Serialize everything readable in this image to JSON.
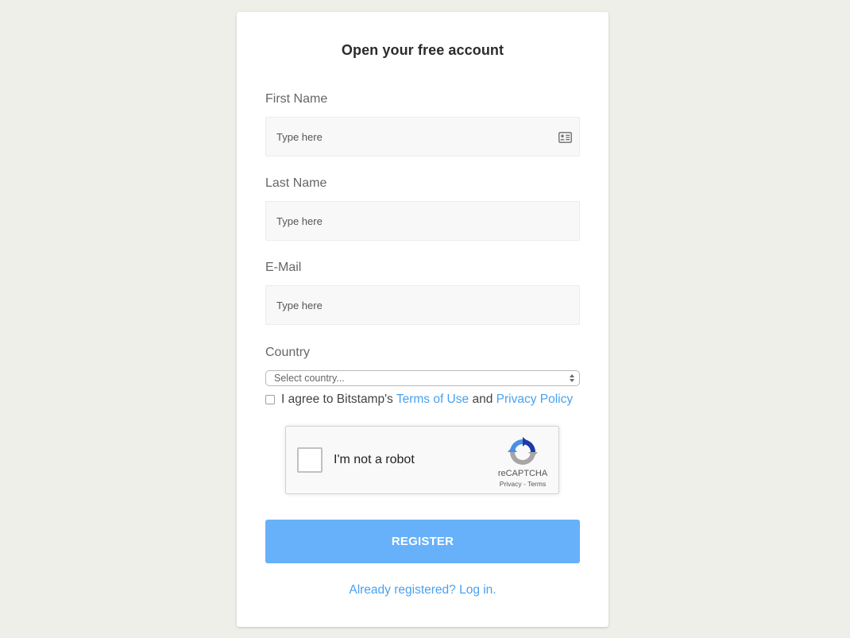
{
  "form": {
    "title": "Open your free account",
    "first_name": {
      "label": "First Name",
      "placeholder": "Type here",
      "value": ""
    },
    "last_name": {
      "label": "Last Name",
      "placeholder": "Type here",
      "value": ""
    },
    "email": {
      "label": "E-Mail",
      "placeholder": "Type here",
      "value": ""
    },
    "country": {
      "label": "Country",
      "selected": "Select country..."
    },
    "agree": {
      "prefix": "I agree to Bitstamp's ",
      "terms_link": "Terms of Use",
      "middle": " and ",
      "privacy_link": "Privacy Policy",
      "checked": false
    },
    "recaptcha": {
      "label": "I'm not a robot",
      "brand": "reCAPTCHA",
      "links": "Privacy - Terms",
      "checked": false
    },
    "register_label": "REGISTER",
    "login_link": "Already registered? Log in."
  },
  "colors": {
    "background": "#efefea",
    "accent": "#66b1fa",
    "link": "#4aa1ef"
  },
  "icons": {
    "first_name_field": "contact-card-icon",
    "country_select": "select-arrows-icon",
    "recaptcha": "recaptcha-logo-icon"
  }
}
